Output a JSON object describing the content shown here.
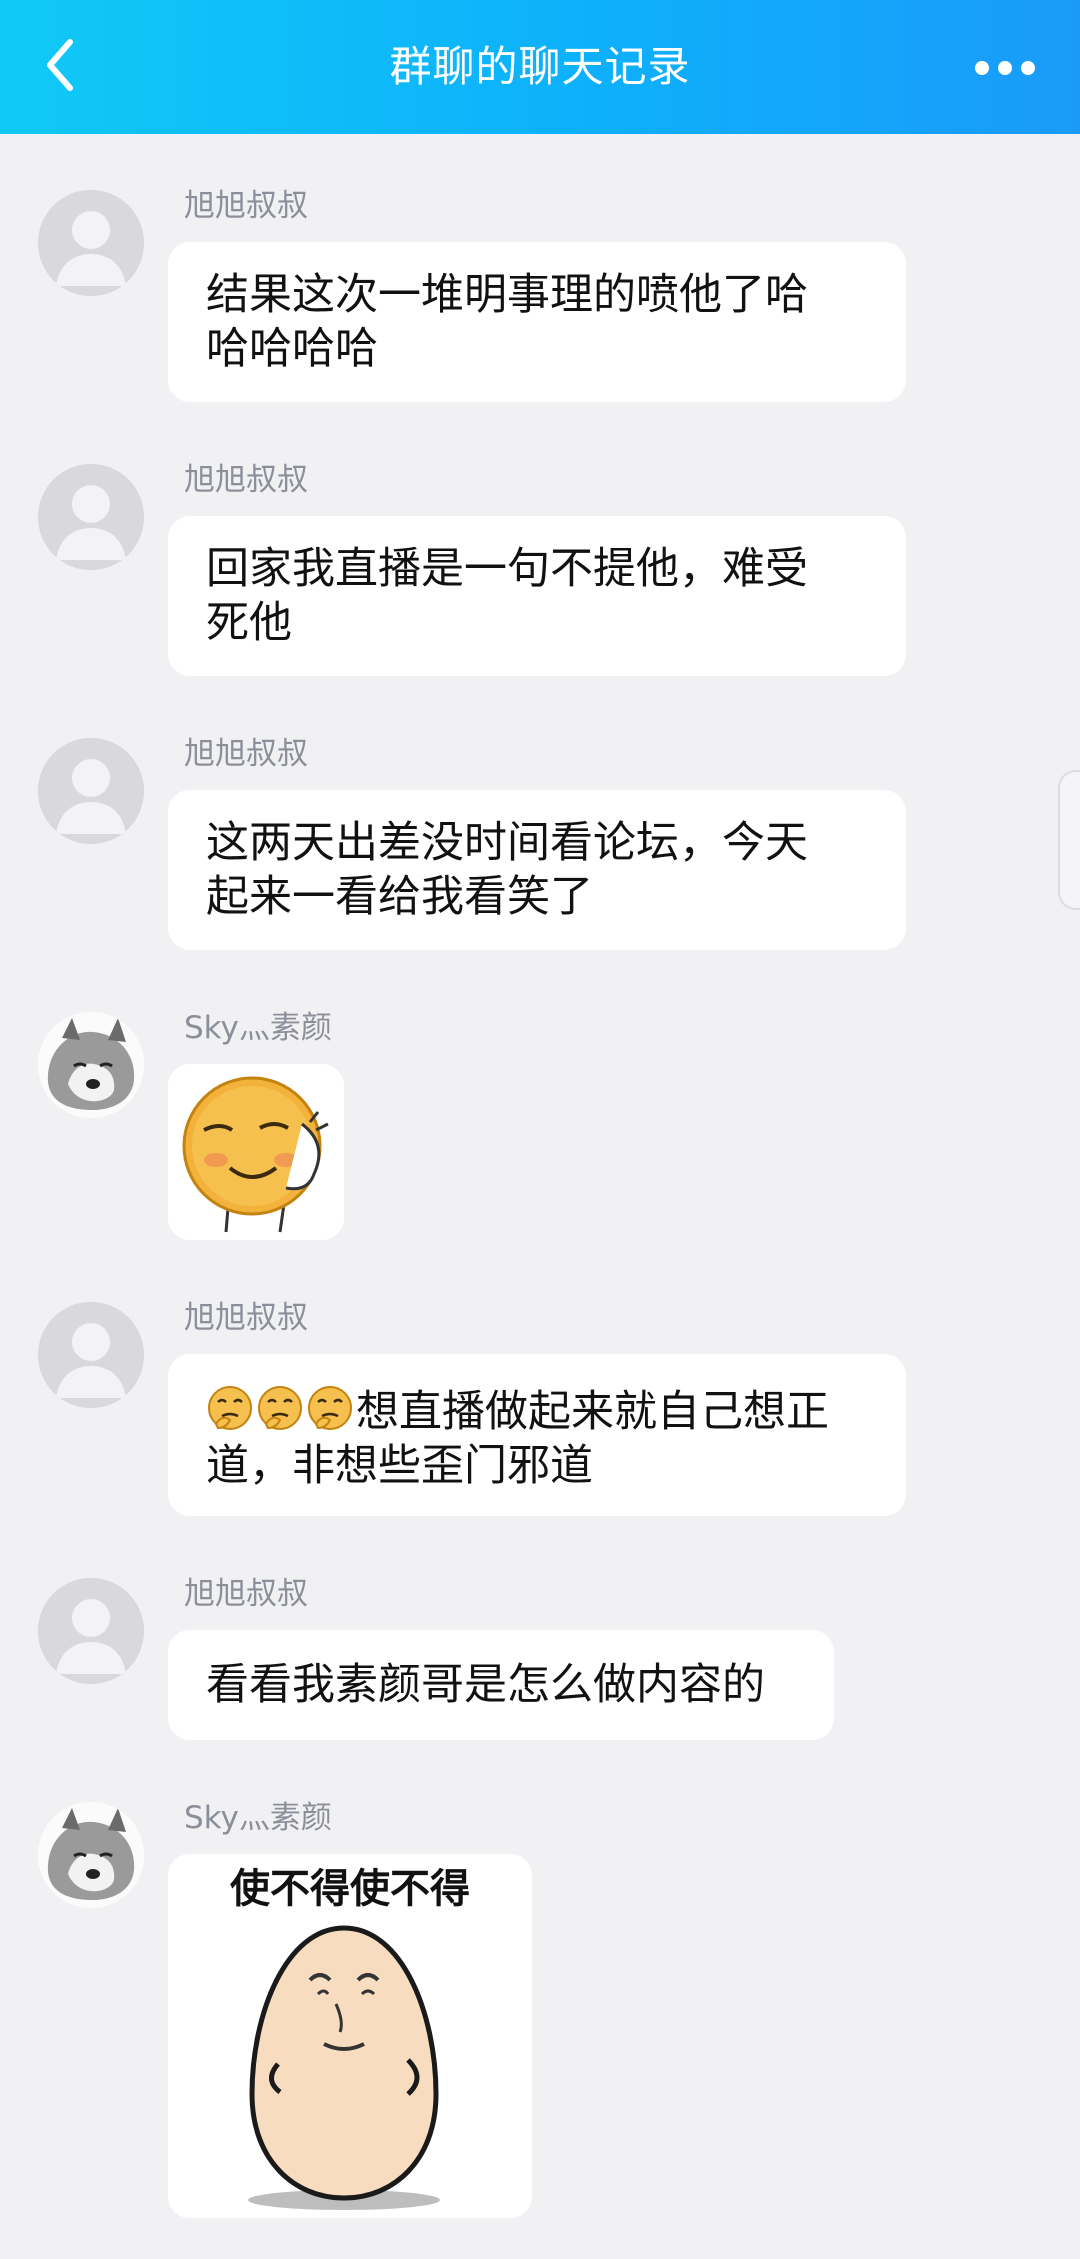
{
  "header": {
    "title": "群聊的聊天记录",
    "back_icon": "chevron-left-icon",
    "more_icon": "more-dots-icon",
    "gradient": [
      "#10c9f6",
      "#1a9bf9"
    ]
  },
  "messages": [
    {
      "sender": "旭旭叔叔",
      "avatar": "default-avatar",
      "text_lines": [
        "结果这次一堆明事理的喷他了哈",
        "哈哈哈哈"
      ]
    },
    {
      "sender": "旭旭叔叔",
      "avatar": "default-avatar",
      "text_lines": [
        "回家我直播是一句不提他，难受",
        "死他"
      ]
    },
    {
      "sender": "旭旭叔叔",
      "avatar": "default-avatar",
      "text_lines": [
        "这两天出差没时间看论坛，今天",
        "起来一看给我看笑了"
      ]
    },
    {
      "sender": "Sky灬素颜",
      "avatar": "husky-avatar",
      "sticker": "smug-face-sticker"
    },
    {
      "sender": "旭旭叔叔",
      "avatar": "default-avatar",
      "emoji": "thinking-emoji",
      "emoji_count": 3,
      "text_lines": [
        "想直播做起来就自己想正",
        "道，非想些歪门邪道"
      ]
    },
    {
      "sender": "旭旭叔叔",
      "avatar": "default-avatar",
      "text_lines": [
        "看看我素颜哥是怎么做内容的"
      ]
    },
    {
      "sender": "Sky灬素颜",
      "avatar": "husky-avatar",
      "sticker": "egg-man-sticker",
      "sticker_caption": "使不得使不得"
    }
  ]
}
